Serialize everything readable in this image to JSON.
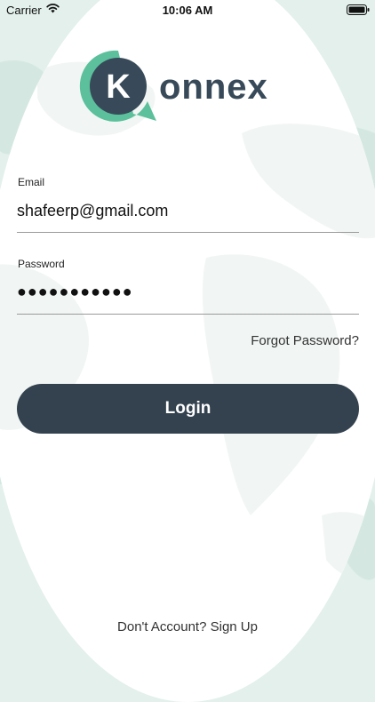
{
  "status_bar": {
    "carrier": "Carrier",
    "time": "10:06 AM",
    "wifi_icon": "wifi-icon",
    "battery_icon": "battery-icon"
  },
  "logo": {
    "mark_letter": "K",
    "wordmark": "onnex",
    "mark_color": "#5cc09c",
    "text_color": "#384a59"
  },
  "email": {
    "label": "Email",
    "value": "shafeerp@gmail.com"
  },
  "password": {
    "label": "Password",
    "value": "●●●●●●●●●●●"
  },
  "forgot_password": "Forgot Password?",
  "login_button": "Login",
  "signup_link": "Don't Account? Sign Up",
  "colors": {
    "background": "#e3f0ec",
    "card": "#ffffff",
    "button": "#34424f"
  }
}
